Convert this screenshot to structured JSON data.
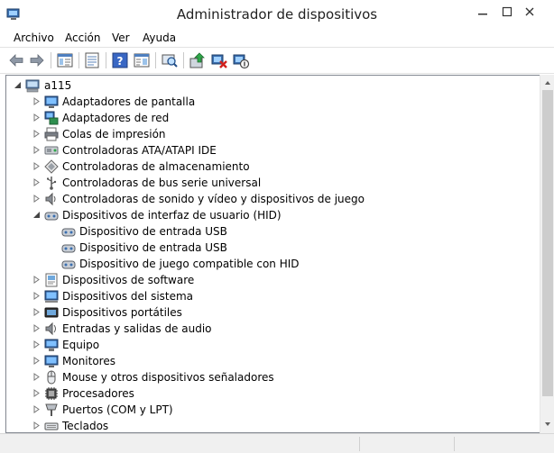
{
  "window": {
    "title": "Administrador de dispositivos"
  },
  "menu": [
    "Archivo",
    "Acción",
    "Ver",
    "Ayuda"
  ],
  "toolbar": {
    "icons": [
      "back-arrow-icon",
      "forward-arrow-icon",
      "show-hide-console-tree-icon",
      "properties-icon",
      "help-icon",
      "action-pane-icon",
      "scan-hardware-icon",
      "update-driver-icon",
      "uninstall-device-icon",
      "disable-device-icon"
    ]
  },
  "tree": {
    "root": "a115",
    "items": [
      {
        "label": "Adaptadores de pantalla",
        "icon": "display-adapter-icon",
        "expanded": false
      },
      {
        "label": "Adaptadores de red",
        "icon": "network-adapter-icon",
        "expanded": false
      },
      {
        "label": "Colas de impresión",
        "icon": "print-queue-icon",
        "expanded": false
      },
      {
        "label": "Controladoras ATA/ATAPI IDE",
        "icon": "ide-controller-icon",
        "expanded": false
      },
      {
        "label": "Controladoras de almacenamiento",
        "icon": "storage-controller-icon",
        "expanded": false
      },
      {
        "label": "Controladoras de bus serie universal",
        "icon": "usb-controller-icon",
        "expanded": false
      },
      {
        "label": "Controladoras de sonido y vídeo y dispositivos de juego",
        "icon": "sound-icon",
        "expanded": false
      },
      {
        "label": "Dispositivos de interfaz de usuario (HID)",
        "icon": "hid-icon",
        "expanded": true,
        "children": [
          "Dispositivo de entrada USB",
          "Dispositivo de entrada USB",
          "Dispositivo de juego  compatible con HID"
        ]
      },
      {
        "label": "Dispositivos de software",
        "icon": "software-device-icon",
        "expanded": false
      },
      {
        "label": "Dispositivos del sistema",
        "icon": "system-device-icon",
        "expanded": false
      },
      {
        "label": "Dispositivos portátiles",
        "icon": "portable-device-icon",
        "expanded": false
      },
      {
        "label": "Entradas y salidas de audio",
        "icon": "audio-io-icon",
        "expanded": false
      },
      {
        "label": "Equipo",
        "icon": "computer-icon",
        "expanded": false
      },
      {
        "label": "Monitores",
        "icon": "monitor-icon",
        "expanded": false
      },
      {
        "label": "Mouse y otros dispositivos señaladores",
        "icon": "mouse-icon",
        "expanded": false
      },
      {
        "label": "Procesadores",
        "icon": "processor-icon",
        "expanded": false
      },
      {
        "label": "Puertos (COM y LPT)",
        "icon": "port-icon",
        "expanded": false
      },
      {
        "label": "Teclados",
        "icon": "keyboard-icon",
        "expanded": false
      }
    ]
  },
  "colors": {
    "selection": "#cce8ff",
    "scrollbar": "#cdcdcd",
    "status": "#f0f0f0"
  }
}
